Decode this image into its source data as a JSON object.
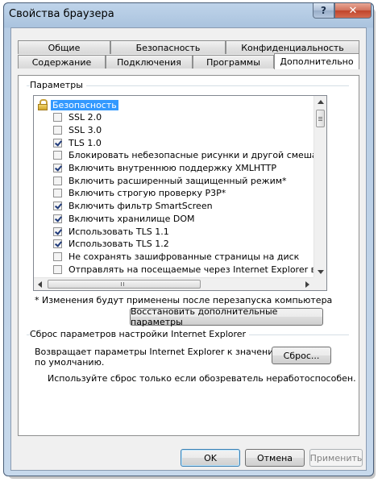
{
  "window": {
    "title": "Свойства браузера",
    "help_glyph": "?",
    "close_glyph": "✕"
  },
  "tabs": {
    "row_back": [
      "Общие",
      "Безопасность",
      "Конфиденциальность"
    ],
    "row_front": [
      "Содержание",
      "Подключения",
      "Программы",
      "Дополнительно"
    ],
    "active": "Дополнительно"
  },
  "params": {
    "group_label": "Параметры",
    "items": [
      {
        "label": "Безопасность",
        "type": "category"
      },
      {
        "label": "SSL 2.0",
        "checked": false
      },
      {
        "label": "SSL 3.0",
        "checked": false
      },
      {
        "label": "TLS 1.0",
        "checked": true
      },
      {
        "label": "Блокировать небезопасные рисунки и другой смешанн",
        "checked": false
      },
      {
        "label": "Включить внутреннюю поддержку XMLHTTP",
        "checked": true
      },
      {
        "label": "Включить расширенный защищенный режим*",
        "checked": false
      },
      {
        "label": "Включить строгую проверку P3P*",
        "checked": false
      },
      {
        "label": "Включить фильтр SmartScreen",
        "checked": true
      },
      {
        "label": "Включить хранилище DOM",
        "checked": true
      },
      {
        "label": "Использовать TLS 1.1",
        "checked": true
      },
      {
        "label": "Использовать TLS 1.2",
        "checked": true
      },
      {
        "label": "Не сохранять зашифрованные страницы на диск",
        "checked": false
      },
      {
        "label": "Отправлять на посещаемые через Internet Explorer ве",
        "checked": false
      }
    ],
    "note": "* Изменения будут применены после перезапуска компьютера",
    "restore_button": "Восстановить дополнительные параметры"
  },
  "reset": {
    "group_label": "Сброс параметров настройки Internet Explorer",
    "description_line1": "Возвращает параметры Internet Explorer к значениям",
    "description_line2": "по умолчанию.",
    "button": "Сброс...",
    "warning": "Используйте сброс только если обозреватель неработоспособен."
  },
  "footer": {
    "ok": "OK",
    "cancel": "Отмена",
    "apply": "Применить"
  }
}
